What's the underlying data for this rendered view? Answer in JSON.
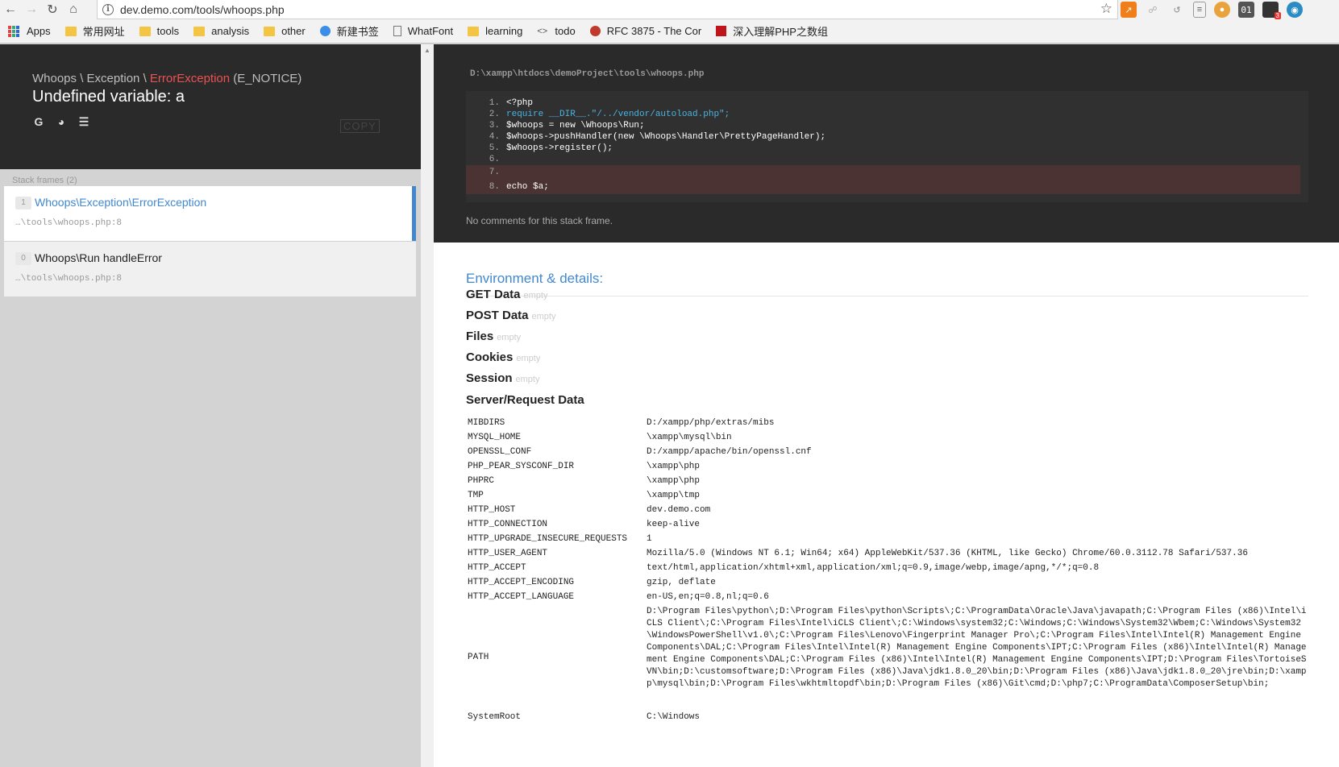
{
  "browser": {
    "url": "dev.demo.com/tools/whoops.php",
    "bookmarks": [
      "Apps",
      "常用网址",
      "tools",
      "analysis",
      "other",
      "新建书签",
      "WhatFont",
      "learning",
      "todo",
      "RFC 3875 - The Cor",
      "深入理解PHP之数组"
    ],
    "ext_badge": "3"
  },
  "error": {
    "namespace": "Whoops \\ Exception \\ ",
    "class": "ErrorException",
    "type": " (E_NOTICE)",
    "message": "Undefined variable: a",
    "copy_label": "COPY"
  },
  "frames": {
    "header": "Stack frames (2)",
    "items": [
      {
        "index": "1",
        "class": "Whoops\\Exception\\ErrorException",
        "file": "…\\tools\\whoops.php:8"
      },
      {
        "index": "0",
        "class": "Whoops\\Run handleError",
        "file": "…\\tools\\whoops.php:8"
      }
    ]
  },
  "code": {
    "path": "D:\\xampp\\htdocs\\demoProject\\tools\\whoops.php",
    "lines": [
      {
        "n": "1.",
        "text": "<?php"
      },
      {
        "n": "2.",
        "text": "require __DIR__.\"/../vendor/autoload.php\";"
      },
      {
        "n": "3.",
        "text": "$whoops = new \\Whoops\\Run;"
      },
      {
        "n": "4.",
        "text": "$whoops->pushHandler(new \\Whoops\\Handler\\PrettyPageHandler);"
      },
      {
        "n": "5.",
        "text": "$whoops->register();"
      },
      {
        "n": "6.",
        "text": ""
      },
      {
        "n": "7.",
        "text": ""
      },
      {
        "n": "8.",
        "text": "echo $a;"
      }
    ],
    "comments": "No comments for this stack frame."
  },
  "env": {
    "title": "Environment & details:",
    "empty_label": "empty",
    "sections": [
      "GET Data",
      "POST Data",
      "Files",
      "Cookies",
      "Session"
    ],
    "server_title": "Server/Request Data",
    "server": [
      [
        "MIBDIRS",
        "D:/xampp/php/extras/mibs"
      ],
      [
        "MYSQL_HOME",
        "\\xampp\\mysql\\bin"
      ],
      [
        "OPENSSL_CONF",
        "D:/xampp/apache/bin/openssl.cnf"
      ],
      [
        "PHP_PEAR_SYSCONF_DIR",
        "\\xampp\\php"
      ],
      [
        "PHPRC",
        "\\xampp\\php"
      ],
      [
        "TMP",
        "\\xampp\\tmp"
      ],
      [
        "HTTP_HOST",
        "dev.demo.com"
      ],
      [
        "HTTP_CONNECTION",
        "keep-alive"
      ],
      [
        "HTTP_UPGRADE_INSECURE_REQUESTS",
        "1"
      ],
      [
        "HTTP_USER_AGENT",
        "Mozilla/5.0 (Windows NT 6.1; Win64; x64) AppleWebKit/537.36 (KHTML, like Gecko) Chrome/60.0.3112.78 Safari/537.36"
      ],
      [
        "HTTP_ACCEPT",
        "text/html,application/xhtml+xml,application/xml;q=0.9,image/webp,image/apng,*/*;q=0.8"
      ],
      [
        "HTTP_ACCEPT_ENCODING",
        "gzip, deflate"
      ],
      [
        "HTTP_ACCEPT_LANGUAGE",
        "en-US,en;q=0.8,nl;q=0.6"
      ],
      [
        "PATH",
        "D:\\Program Files\\python\\;D:\\Program Files\\python\\Scripts\\;C:\\ProgramData\\Oracle\\Java\\javapath;C:\\Program Files (x86)\\Intel\\iCLS Client\\;C:\\Program Files\\Intel\\iCLS Client\\;C:\\Windows\\system32;C:\\Windows;C:\\Windows\\System32\\Wbem;C:\\Windows\\System32\\WindowsPowerShell\\v1.0\\;C:\\Program Files\\Lenovo\\Fingerprint Manager Pro\\;C:\\Program Files\\Intel\\Intel(R) Management Engine Components\\DAL;C:\\Program Files\\Intel\\Intel(R) Management Engine Components\\IPT;C:\\Program Files (x86)\\Intel\\Intel(R) Management Engine Components\\DAL;C:\\Program Files (x86)\\Intel\\Intel(R) Management Engine Components\\IPT;D:\\Program Files\\TortoiseSVN\\bin;D:\\customsoftware;D:\\Program Files (x86)\\Java\\jdk1.8.0_20\\bin;D:\\Program Files (x86)\\Java\\jdk1.8.0_20\\jre\\bin;D:\\xampp\\mysql\\bin;D:\\Program Files\\wkhtmltopdf\\bin;D:\\Program Files (x86)\\Git\\cmd;D:\\php7;C:\\ProgramData\\ComposerSetup\\bin;"
      ],
      [
        "SystemRoot",
        "C:\\Windows"
      ]
    ]
  }
}
